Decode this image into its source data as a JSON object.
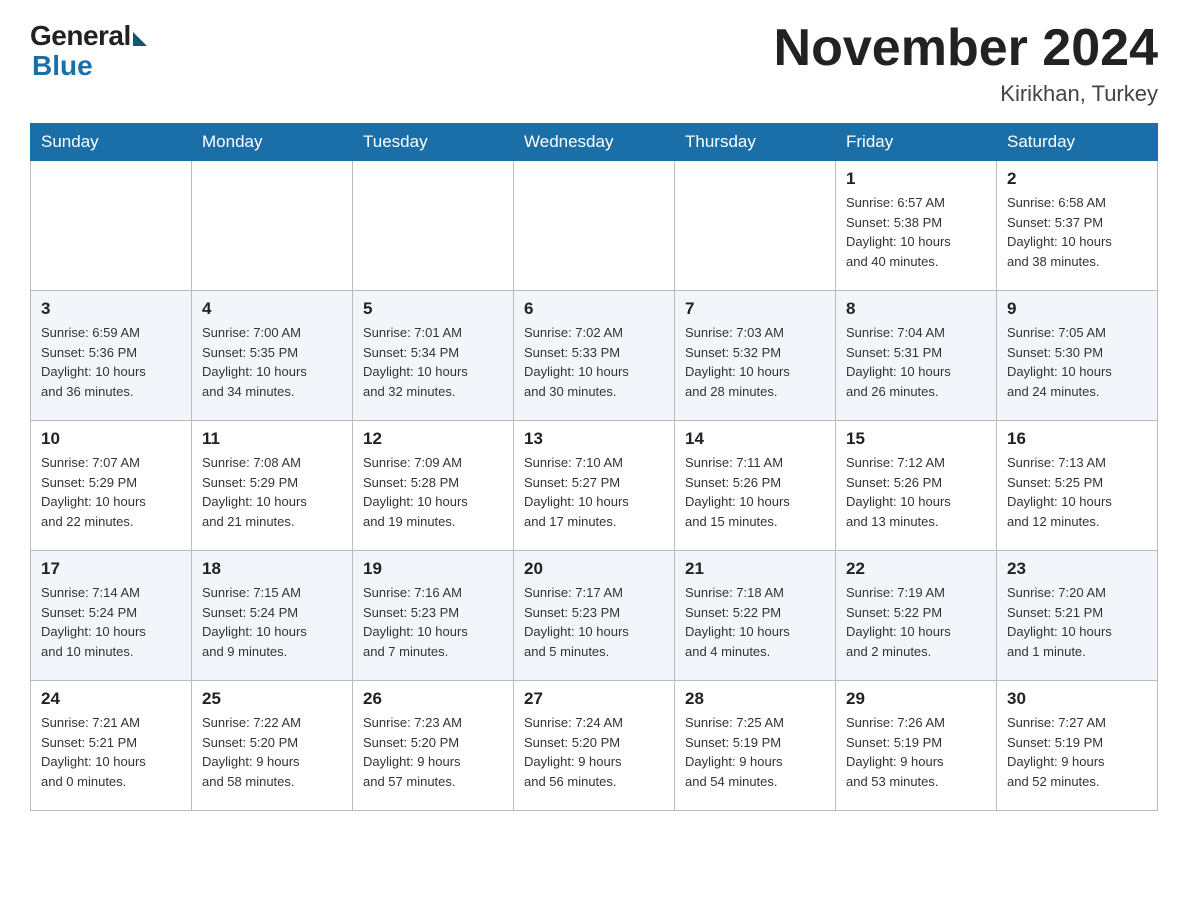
{
  "header": {
    "logo": {
      "general": "General",
      "blue": "Blue"
    },
    "title": "November 2024",
    "location": "Kirikhan, Turkey"
  },
  "weekdays": [
    "Sunday",
    "Monday",
    "Tuesday",
    "Wednesday",
    "Thursday",
    "Friday",
    "Saturday"
  ],
  "weeks": [
    [
      {
        "day": "",
        "info": ""
      },
      {
        "day": "",
        "info": ""
      },
      {
        "day": "",
        "info": ""
      },
      {
        "day": "",
        "info": ""
      },
      {
        "day": "",
        "info": ""
      },
      {
        "day": "1",
        "info": "Sunrise: 6:57 AM\nSunset: 5:38 PM\nDaylight: 10 hours\nand 40 minutes."
      },
      {
        "day": "2",
        "info": "Sunrise: 6:58 AM\nSunset: 5:37 PM\nDaylight: 10 hours\nand 38 minutes."
      }
    ],
    [
      {
        "day": "3",
        "info": "Sunrise: 6:59 AM\nSunset: 5:36 PM\nDaylight: 10 hours\nand 36 minutes."
      },
      {
        "day": "4",
        "info": "Sunrise: 7:00 AM\nSunset: 5:35 PM\nDaylight: 10 hours\nand 34 minutes."
      },
      {
        "day": "5",
        "info": "Sunrise: 7:01 AM\nSunset: 5:34 PM\nDaylight: 10 hours\nand 32 minutes."
      },
      {
        "day": "6",
        "info": "Sunrise: 7:02 AM\nSunset: 5:33 PM\nDaylight: 10 hours\nand 30 minutes."
      },
      {
        "day": "7",
        "info": "Sunrise: 7:03 AM\nSunset: 5:32 PM\nDaylight: 10 hours\nand 28 minutes."
      },
      {
        "day": "8",
        "info": "Sunrise: 7:04 AM\nSunset: 5:31 PM\nDaylight: 10 hours\nand 26 minutes."
      },
      {
        "day": "9",
        "info": "Sunrise: 7:05 AM\nSunset: 5:30 PM\nDaylight: 10 hours\nand 24 minutes."
      }
    ],
    [
      {
        "day": "10",
        "info": "Sunrise: 7:07 AM\nSunset: 5:29 PM\nDaylight: 10 hours\nand 22 minutes."
      },
      {
        "day": "11",
        "info": "Sunrise: 7:08 AM\nSunset: 5:29 PM\nDaylight: 10 hours\nand 21 minutes."
      },
      {
        "day": "12",
        "info": "Sunrise: 7:09 AM\nSunset: 5:28 PM\nDaylight: 10 hours\nand 19 minutes."
      },
      {
        "day": "13",
        "info": "Sunrise: 7:10 AM\nSunset: 5:27 PM\nDaylight: 10 hours\nand 17 minutes."
      },
      {
        "day": "14",
        "info": "Sunrise: 7:11 AM\nSunset: 5:26 PM\nDaylight: 10 hours\nand 15 minutes."
      },
      {
        "day": "15",
        "info": "Sunrise: 7:12 AM\nSunset: 5:26 PM\nDaylight: 10 hours\nand 13 minutes."
      },
      {
        "day": "16",
        "info": "Sunrise: 7:13 AM\nSunset: 5:25 PM\nDaylight: 10 hours\nand 12 minutes."
      }
    ],
    [
      {
        "day": "17",
        "info": "Sunrise: 7:14 AM\nSunset: 5:24 PM\nDaylight: 10 hours\nand 10 minutes."
      },
      {
        "day": "18",
        "info": "Sunrise: 7:15 AM\nSunset: 5:24 PM\nDaylight: 10 hours\nand 9 minutes."
      },
      {
        "day": "19",
        "info": "Sunrise: 7:16 AM\nSunset: 5:23 PM\nDaylight: 10 hours\nand 7 minutes."
      },
      {
        "day": "20",
        "info": "Sunrise: 7:17 AM\nSunset: 5:23 PM\nDaylight: 10 hours\nand 5 minutes."
      },
      {
        "day": "21",
        "info": "Sunrise: 7:18 AM\nSunset: 5:22 PM\nDaylight: 10 hours\nand 4 minutes."
      },
      {
        "day": "22",
        "info": "Sunrise: 7:19 AM\nSunset: 5:22 PM\nDaylight: 10 hours\nand 2 minutes."
      },
      {
        "day": "23",
        "info": "Sunrise: 7:20 AM\nSunset: 5:21 PM\nDaylight: 10 hours\nand 1 minute."
      }
    ],
    [
      {
        "day": "24",
        "info": "Sunrise: 7:21 AM\nSunset: 5:21 PM\nDaylight: 10 hours\nand 0 minutes."
      },
      {
        "day": "25",
        "info": "Sunrise: 7:22 AM\nSunset: 5:20 PM\nDaylight: 9 hours\nand 58 minutes."
      },
      {
        "day": "26",
        "info": "Sunrise: 7:23 AM\nSunset: 5:20 PM\nDaylight: 9 hours\nand 57 minutes."
      },
      {
        "day": "27",
        "info": "Sunrise: 7:24 AM\nSunset: 5:20 PM\nDaylight: 9 hours\nand 56 minutes."
      },
      {
        "day": "28",
        "info": "Sunrise: 7:25 AM\nSunset: 5:19 PM\nDaylight: 9 hours\nand 54 minutes."
      },
      {
        "day": "29",
        "info": "Sunrise: 7:26 AM\nSunset: 5:19 PM\nDaylight: 9 hours\nand 53 minutes."
      },
      {
        "day": "30",
        "info": "Sunrise: 7:27 AM\nSunset: 5:19 PM\nDaylight: 9 hours\nand 52 minutes."
      }
    ]
  ]
}
